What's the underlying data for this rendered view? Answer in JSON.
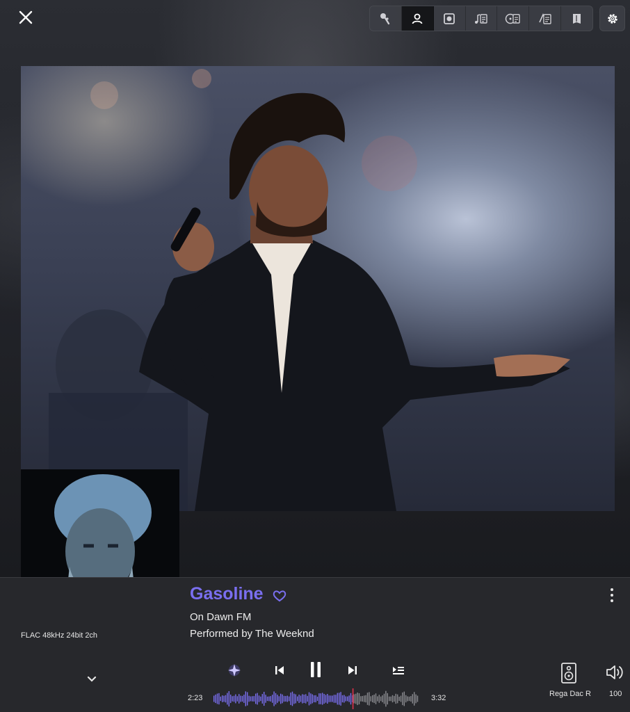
{
  "header": {
    "close_icon": "close-icon",
    "toolbar": [
      {
        "name": "microphone-icon",
        "active": false
      },
      {
        "name": "artist-icon",
        "active": true
      },
      {
        "name": "album-icon",
        "active": false
      },
      {
        "name": "lyrics-icon",
        "active": false
      },
      {
        "name": "credits-icon",
        "active": false
      },
      {
        "name": "info-icon",
        "active": false
      },
      {
        "name": "booklet-icon",
        "active": false
      }
    ],
    "settings_icon": "gear-icon"
  },
  "now_playing": {
    "format": "FLAC 48kHz 24bit 2ch",
    "title": "Gasoline",
    "album": "On Dawn FM",
    "performer": "Performed by The Weeknd",
    "favorite": true
  },
  "playback": {
    "elapsed": "2:23",
    "duration": "3:32",
    "progress": 0.675,
    "state": "playing"
  },
  "output": {
    "device": "Rega Dac R",
    "volume": "100"
  },
  "colors": {
    "accent": "#7a6ff0",
    "panel": "#27282c",
    "progress_marker": "#e0304a"
  }
}
